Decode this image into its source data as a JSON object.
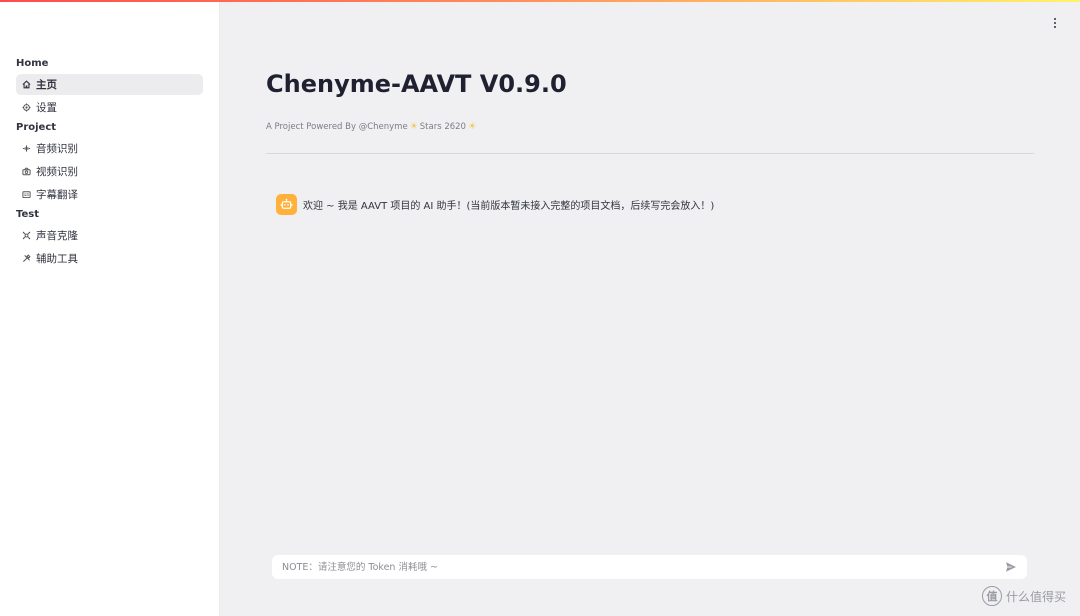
{
  "sidebar": {
    "sections": [
      {
        "title": "Home",
        "items": [
          {
            "label": "主页",
            "icon": "home-icon"
          },
          {
            "label": "设置",
            "icon": "gear-icon"
          }
        ]
      },
      {
        "title": "Project",
        "items": [
          {
            "label": "音频识别",
            "icon": "audio-wave-icon"
          },
          {
            "label": "视频识别",
            "icon": "video-camera-icon"
          },
          {
            "label": "字幕翻译",
            "icon": "subtitle-icon"
          }
        ]
      },
      {
        "title": "Test",
        "items": [
          {
            "label": "声音克隆",
            "icon": "voice-clone-icon"
          },
          {
            "label": "辅助工具",
            "icon": "tools-icon"
          }
        ]
      }
    ],
    "active_item": "主页"
  },
  "main": {
    "title": "Chenyme-AAVT V0.9.0",
    "subtitle_prefix": "A Project Powered By @Chenyme",
    "subtitle_stars": "Stars 2620",
    "chat": {
      "avatar_icon": "robot-icon",
      "message": "欢迎 ~ 我是 AAVT 项目的 AI 助手！(当前版本暂未接入完整的项目文档，后续写完会放入！)"
    },
    "input": {
      "placeholder": "NOTE：请注意您的 Token 消耗哦 ~",
      "value": ""
    }
  },
  "watermark": {
    "icon_char": "值",
    "text": "什么值得买"
  },
  "colors": {
    "accent_gradient_start": "#ff4b4b",
    "accent_gradient_end": "#fff36b",
    "avatar_bg": "#ffb13b",
    "sidebar_bg": "#ffffff",
    "main_bg": "#f0f0f2"
  }
}
